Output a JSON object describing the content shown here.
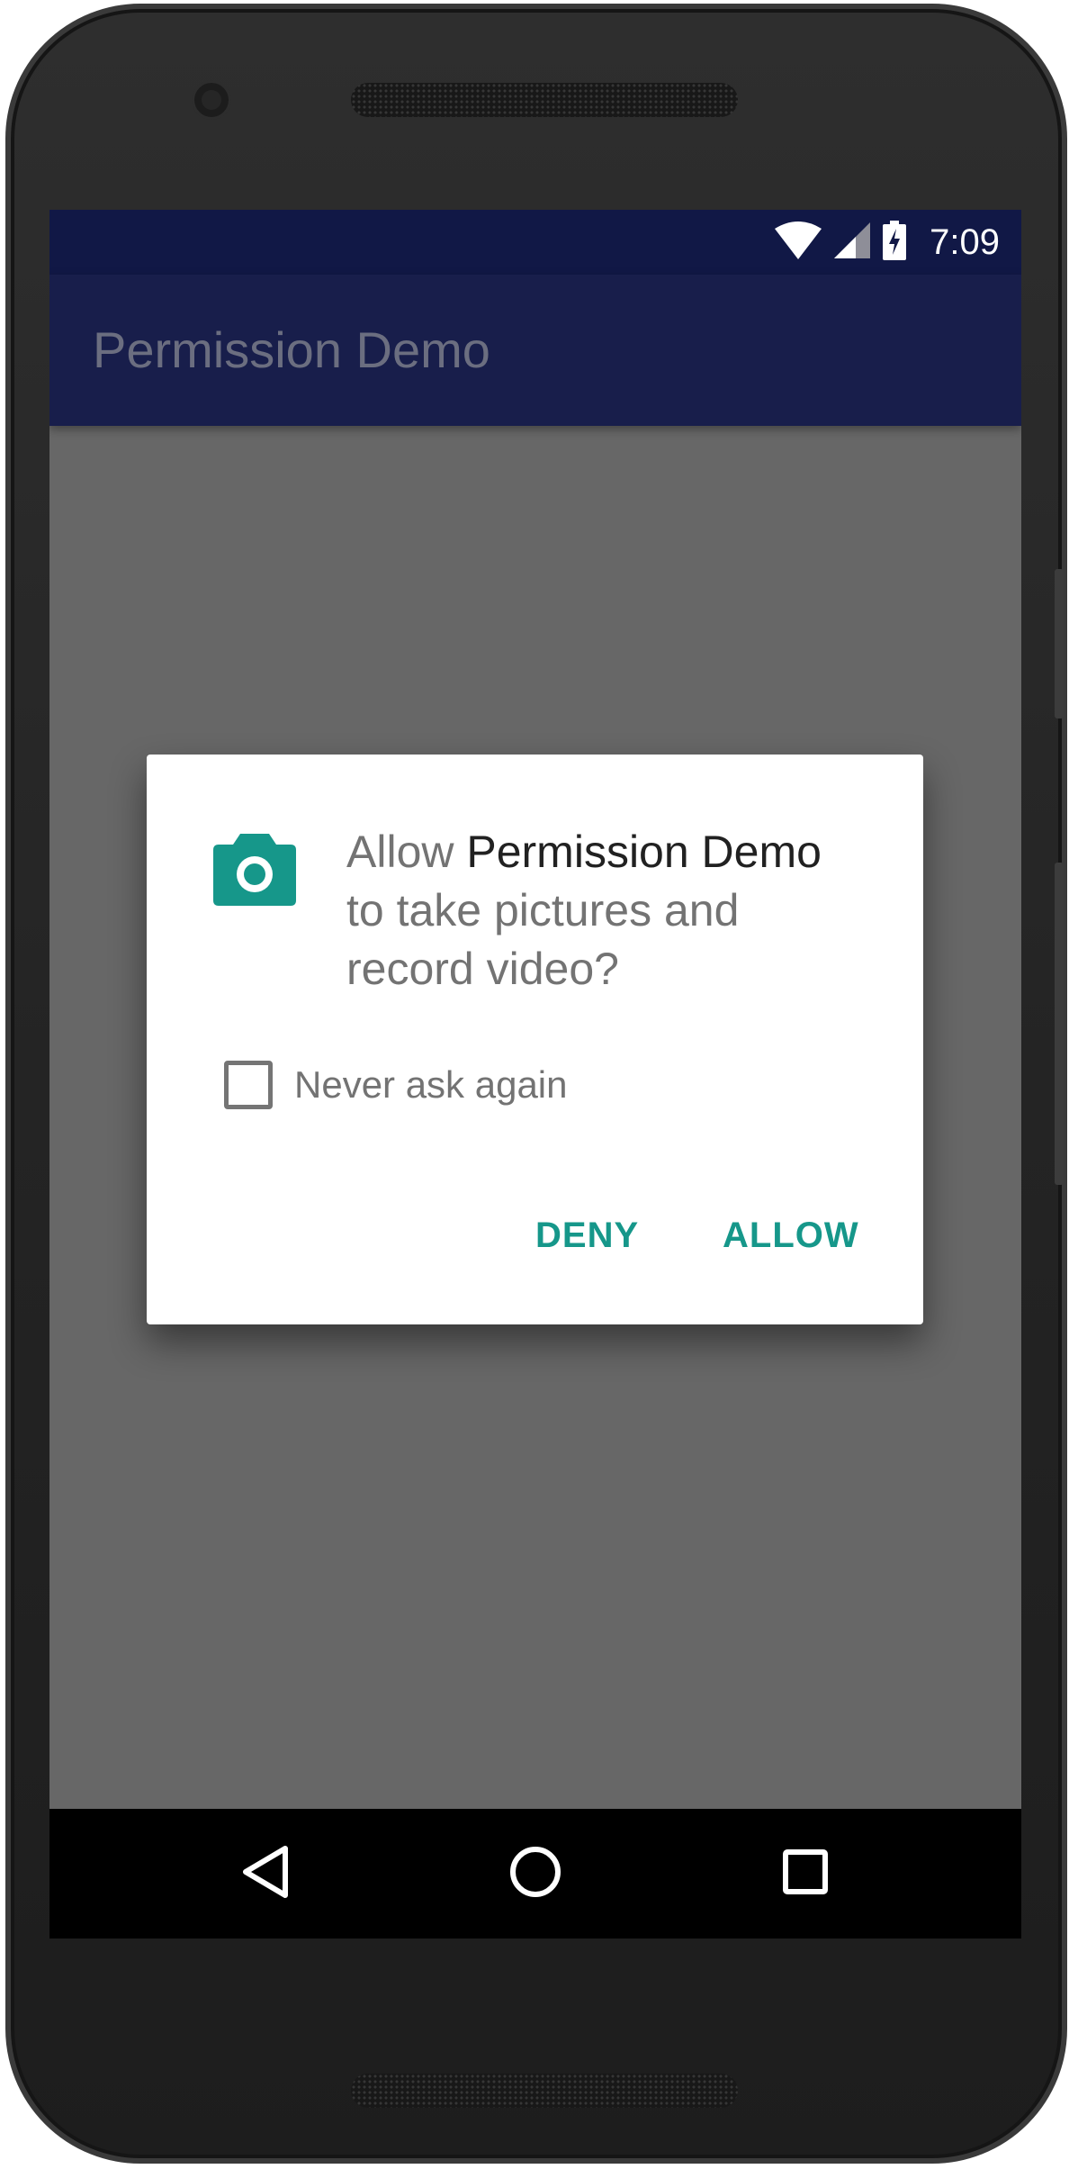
{
  "status_bar": {
    "time": "7:09",
    "icons": [
      "wifi-icon",
      "cell-signal-icon",
      "battery-charging-icon"
    ]
  },
  "app_bar": {
    "title": "Permission Demo"
  },
  "dialog": {
    "icon": "camera-icon",
    "message_prefix": "Allow ",
    "app_name": "Permission Demo",
    "message_suffix": " to take pictures and record video?",
    "checkbox_label": "Never ask again",
    "checkbox_checked": false,
    "deny_label": "DENY",
    "allow_label": "ALLOW"
  },
  "nav_bar": {
    "buttons": [
      "back-icon",
      "home-icon",
      "recents-icon"
    ]
  },
  "colors": {
    "accent": "#16978a",
    "status_bar": "#111846",
    "app_bar": "#181e4b",
    "scrim": "#676767"
  }
}
